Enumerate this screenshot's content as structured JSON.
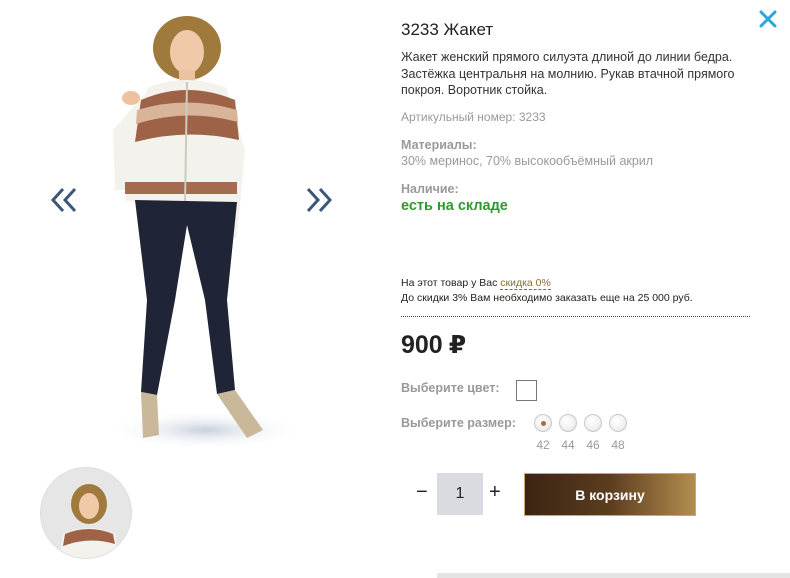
{
  "product": {
    "title": "3233 Жакет",
    "description": "Жакет женский прямого силуэта длиной до линии бедра. Застёжка центральня на молнию. Рукав втачной прямого покроя. Воротник стойка.",
    "sku_label": "Артикульный номер:",
    "sku_value": "3233",
    "materials_label": "Материалы:",
    "materials_value": "30% меринос, 70% высокообъёмный акрил",
    "availability_label": "Наличие:",
    "availability_value": "есть на складе"
  },
  "discount": {
    "line1_prefix": "На этот товар у Вас",
    "line1_link": "скидка 0%",
    "line2": "До скидки 3% Вам необходимо заказать еще на 25 000 руб."
  },
  "price": {
    "amount": "900",
    "currency": "₽"
  },
  "color": {
    "label": "Выберите цвет:"
  },
  "size": {
    "label": "Выберите размер:",
    "options": [
      "42",
      "44",
      "46",
      "48"
    ],
    "selected": "42"
  },
  "quantity": {
    "minus": "−",
    "value": "1",
    "plus": "+"
  },
  "cart_button": "В корзину",
  "colors": {
    "availability": "#2e9a2e",
    "arrow": "#3d5577",
    "close": "#2aa7d8",
    "cart_dark": "#3a2412",
    "cart_light": "#b38d4f"
  },
  "icons": {
    "close": "close-icon",
    "prev": "double-chevron-left-icon",
    "next": "double-chevron-right-icon"
  }
}
